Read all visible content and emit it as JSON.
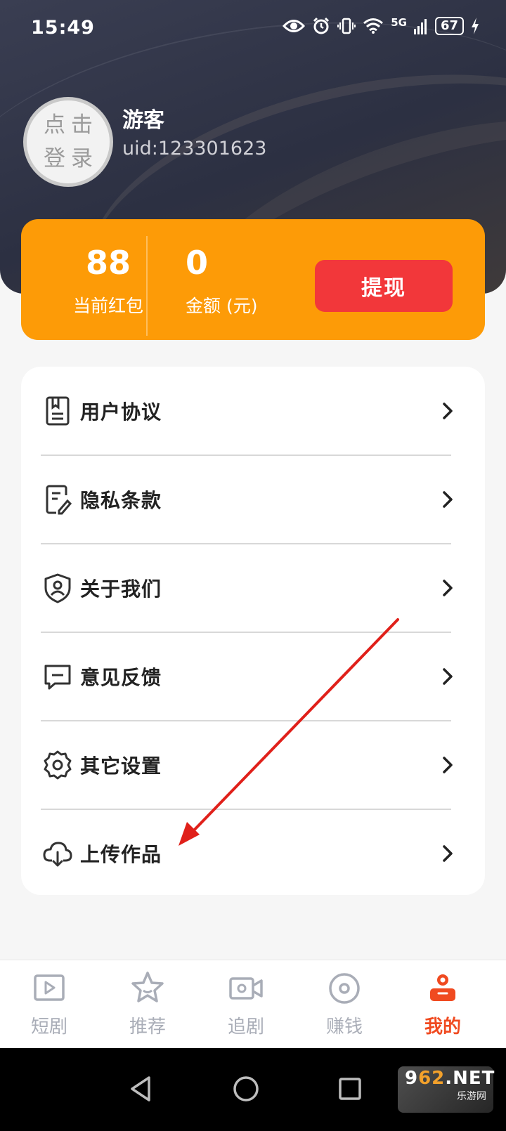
{
  "status_bar": {
    "time": "15:49",
    "network": "5G",
    "battery": "67",
    "icons": [
      "eye-icon",
      "alarm-icon",
      "vibrate-icon",
      "wifi-icon",
      "signal-icon",
      "battery-icon",
      "charging-icon"
    ]
  },
  "profile": {
    "avatar_text_line1": "点击",
    "avatar_text_line2": "登录",
    "username": "游客",
    "uid": "uid:123301623"
  },
  "wallet": {
    "red_packet_value": "88",
    "red_packet_label": "当前红包",
    "amount_value": "0",
    "amount_label": "金额 (元)",
    "withdraw_label": "提现",
    "card_color": "#fd9b07",
    "button_color": "#f2373a"
  },
  "menu": {
    "items": [
      {
        "label": "用户协议",
        "icon": "document-icon"
      },
      {
        "label": "隐私条款",
        "icon": "edit-document-icon"
      },
      {
        "label": "关于我们",
        "icon": "shield-user-icon"
      },
      {
        "label": "意见反馈",
        "icon": "message-icon"
      },
      {
        "label": "其它设置",
        "icon": "gear-icon"
      },
      {
        "label": "上传作品",
        "icon": "cloud-download-icon"
      }
    ]
  },
  "annotation": {
    "color": "#e0201a"
  },
  "bottom_nav": {
    "items": [
      {
        "label": "短剧",
        "icon": "play-box-icon",
        "active": false
      },
      {
        "label": "推荐",
        "icon": "star-icon",
        "active": false
      },
      {
        "label": "追剧",
        "icon": "video-camera-icon",
        "active": false
      },
      {
        "label": "赚钱",
        "icon": "coin-icon",
        "active": false
      },
      {
        "label": "我的",
        "icon": "user-icon",
        "active": true
      }
    ],
    "active_color": "#f04a20",
    "inactive_color": "#a9adb7"
  },
  "system_nav": {
    "buttons": [
      "back-icon",
      "home-icon",
      "recents-icon"
    ]
  },
  "watermark": {
    "brand_prefix": "9",
    "brand_highlight": "62",
    "brand_suffix": ".NET",
    "subtitle": "乐游网"
  }
}
